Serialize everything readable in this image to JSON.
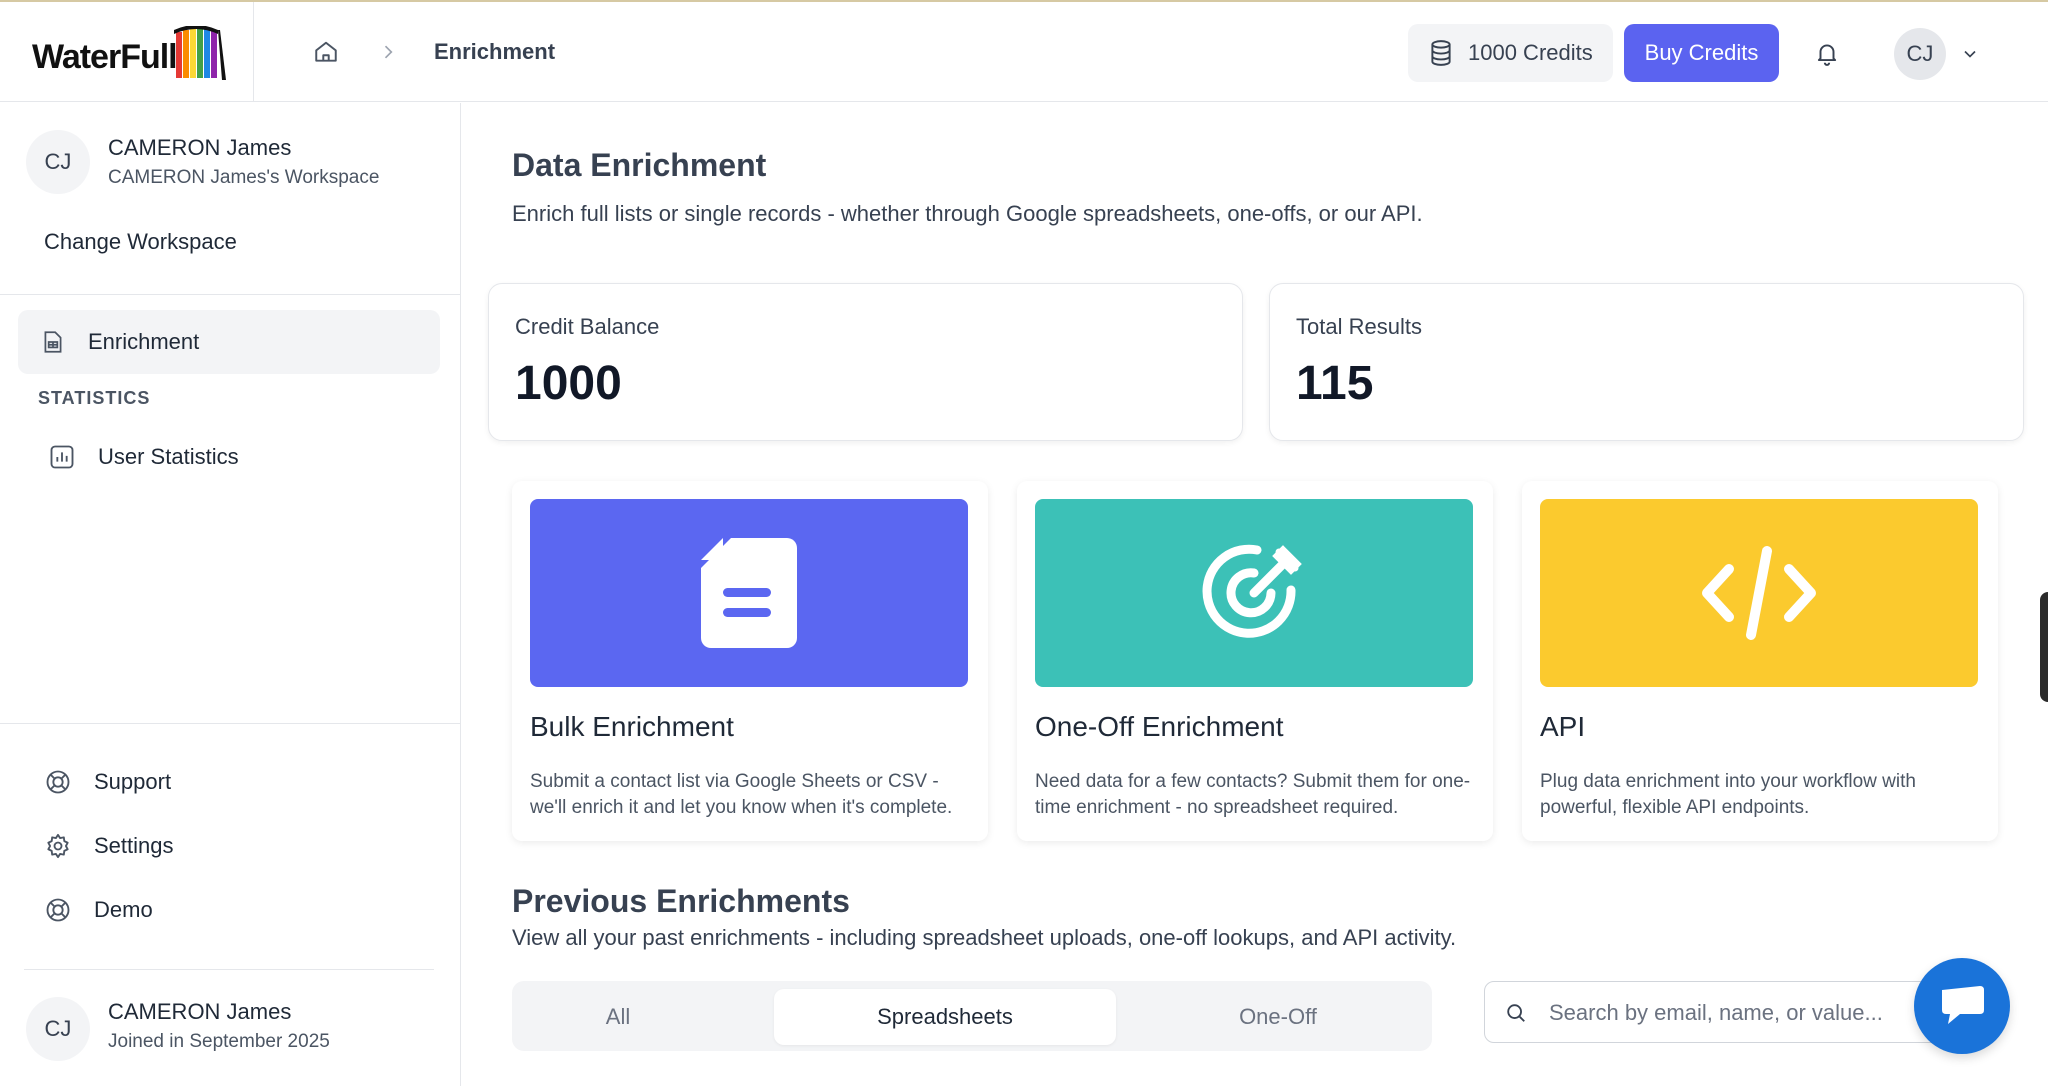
{
  "app": {
    "logo_text": "WaterFull"
  },
  "header": {
    "breadcrumb_current": "Enrichment",
    "credits_label": "1000 Credits",
    "buy_label": "Buy Credits",
    "avatar_initials": "CJ"
  },
  "sidebar": {
    "workspace": {
      "initials": "CJ",
      "name": "CAMERON James",
      "subtitle": "CAMERON James's Workspace",
      "change_label": "Change Workspace"
    },
    "nav_active": {
      "label": "Enrichment",
      "icon": "sheet-icon"
    },
    "section_label": "STATISTICS",
    "nav_items": [
      {
        "label": "User Statistics",
        "icon": "chart-icon"
      }
    ],
    "bottom_items": [
      {
        "label": "Support",
        "icon": "lifebuoy-icon"
      },
      {
        "label": "Settings",
        "icon": "gear-icon"
      },
      {
        "label": "Demo",
        "icon": "lifebuoy-icon"
      }
    ],
    "footer": {
      "initials": "CJ",
      "name": "CAMERON James",
      "subtitle": "Joined in September 2025"
    }
  },
  "main": {
    "title": "Data Enrichment",
    "subtitle": "Enrich full lists or single records - whether through Google spreadsheets, one-offs, or our API.",
    "stats": [
      {
        "label": "Credit Balance",
        "value": "1000"
      },
      {
        "label": "Total Results",
        "value": "115"
      }
    ],
    "features": [
      {
        "title": "Bulk Enrichment",
        "description": "Submit a contact list via Google Sheets or CSV - we'll enrich it and let you know when it's complete.",
        "color": "#5b67f1",
        "icon": "document-icon"
      },
      {
        "title": "One-Off Enrichment",
        "description": "Need data for a few contacts? Submit them for one-time enrichment - no spreadsheet required.",
        "color": "#3cc1b7",
        "icon": "target-icon"
      },
      {
        "title": "API",
        "description": "Plug data enrichment into your workflow with powerful, flexible API endpoints.",
        "color": "#fbca2e",
        "icon": "code-icon"
      }
    ],
    "previous": {
      "title": "Previous Enrichments",
      "subtitle": "View all your past enrichments - including spreadsheet uploads, one-off lookups, and API activity.",
      "tabs": [
        {
          "label": "All",
          "active": false
        },
        {
          "label": "Spreadsheets",
          "active": true
        },
        {
          "label": "One-Off",
          "active": false
        }
      ],
      "search_placeholder": "Search by email, name, or value..."
    }
  },
  "colors": {
    "accent": "#5b63f0",
    "chat": "#1a73d9"
  }
}
